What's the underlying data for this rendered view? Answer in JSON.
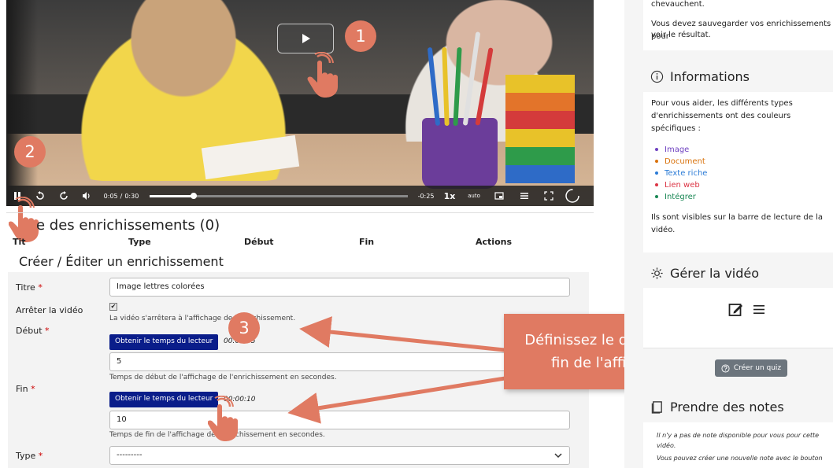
{
  "video": {
    "current_time": "0:05",
    "separator": "/",
    "duration": "0:30",
    "remaining": "-0:25",
    "speed": "1x",
    "quality": "auto",
    "progress_fraction": 0.17
  },
  "badges": {
    "one": "1",
    "two": "2",
    "three": "3"
  },
  "enrichment_list": {
    "title": "Liste des enrichissements (0)",
    "title_tail": "Li",
    "columns": [
      "Titre",
      "Type",
      "Début",
      "Fin",
      "Actions"
    ],
    "column_first_visible": "Tit"
  },
  "form": {
    "title": "Créer / Éditer un enrichissement",
    "required_mark": "*",
    "title_label": "Titre",
    "title_value": "Image lettres colorées",
    "stop_label": "Arrêter la vidéo",
    "stop_checked": "✔",
    "stop_help": "La vidéo s'arrêtera à l'affichage de l'enrichissement.",
    "start_label": "Début",
    "get_time_button": "Obtenir le temps du lecteur",
    "start_time": "00:00:05",
    "start_value": "5",
    "start_help": "Temps de début de l'affichage de l'enrichissement en secondes.",
    "end_label": "Fin",
    "end_time": "00:00:10",
    "end_value": "10",
    "end_help": "Temps de fin de l'affichage de l'enrichissement en secondes.",
    "type_label": "Type",
    "type_value": "---------"
  },
  "callout": {
    "line1": "Définissez le début et la",
    "line2": "fin de l'affichage"
  },
  "right_panel": {
    "top_line1": "chevauchent.",
    "top_line2": "Vous devez sauvegarder vos enrichissements pour",
    "top_line3": "voir le résultat.",
    "info_title": "Informations",
    "info_line1": "Pour vous aider, les différents types",
    "info_line2": "d'enrichissements ont des couleurs",
    "info_line3": "spécifiques :",
    "legend": [
      {
        "label": "Image",
        "color": "#6f42c1"
      },
      {
        "label": "Document",
        "color": "#d9730d"
      },
      {
        "label": "Texte riche",
        "color": "#2b7bd6"
      },
      {
        "label": "Lien web",
        "color": "#dc3545"
      },
      {
        "label": "Intégrer",
        "color": "#198754"
      }
    ],
    "visible_line1": "Ils sont visibles sur la barre de lecture de la",
    "visible_line2": "vidéo.",
    "manage_title": "Gérer la vidéo",
    "quiz_button": "Créer un quiz",
    "notes_title": "Prendre des notes",
    "notes_line1": "Il n'y a pas de note disponible pour vous pour cette",
    "notes_line2": "vidéo.",
    "notes_line3": "Vous pouvez créer une nouvelle note avec le bouton"
  },
  "colors": {
    "accent_callout": "#e07a62",
    "button_blue": "#0a1d8a",
    "required": "#cc0000"
  }
}
